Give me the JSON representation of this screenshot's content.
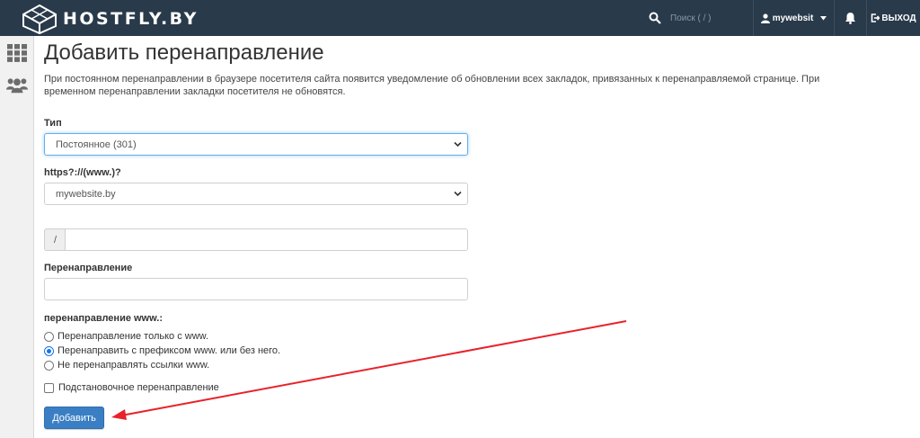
{
  "header": {
    "logo_text": "HOSTFLY.BY",
    "search_placeholder": "Поиск ( / )",
    "username": "mywebsit",
    "logout_label": "ВЫХОД"
  },
  "sidebar": {
    "items": [
      {
        "icon": "grid-icon"
      },
      {
        "icon": "users-icon"
      }
    ]
  },
  "page": {
    "title": "Добавить перенаправление",
    "description": "При постоянном перенаправлении в браузере посетителя сайта появится уведомление об обновлении всех закладок, привязанных к перенаправляемой странице. При временном перенаправлении закладки посетителя не обновятся."
  },
  "form": {
    "type_label": "Тип",
    "type_value": "Постоянное (301)",
    "domain_label": "https?://(www.)?",
    "domain_value": "mywebsite.by",
    "path_prefix": "/",
    "path_value": "",
    "redirect_label": "Перенаправление",
    "redirect_value": "",
    "www_label": "перенаправление www.:",
    "www_options": [
      {
        "label": "Перенаправление только с www.",
        "checked": false
      },
      {
        "label": "Перенаправить с префиксом www. или без него.",
        "checked": true
      },
      {
        "label": "Не перенаправлять ссылки www.",
        "checked": false
      }
    ],
    "wildcard_label": "Подстановочное перенаправление",
    "wildcard_checked": false,
    "submit_label": "Добавить"
  },
  "colors": {
    "header_bg": "#293a4a",
    "primary_button": "#3a7fc4",
    "annotation_arrow": "#e8222a"
  }
}
